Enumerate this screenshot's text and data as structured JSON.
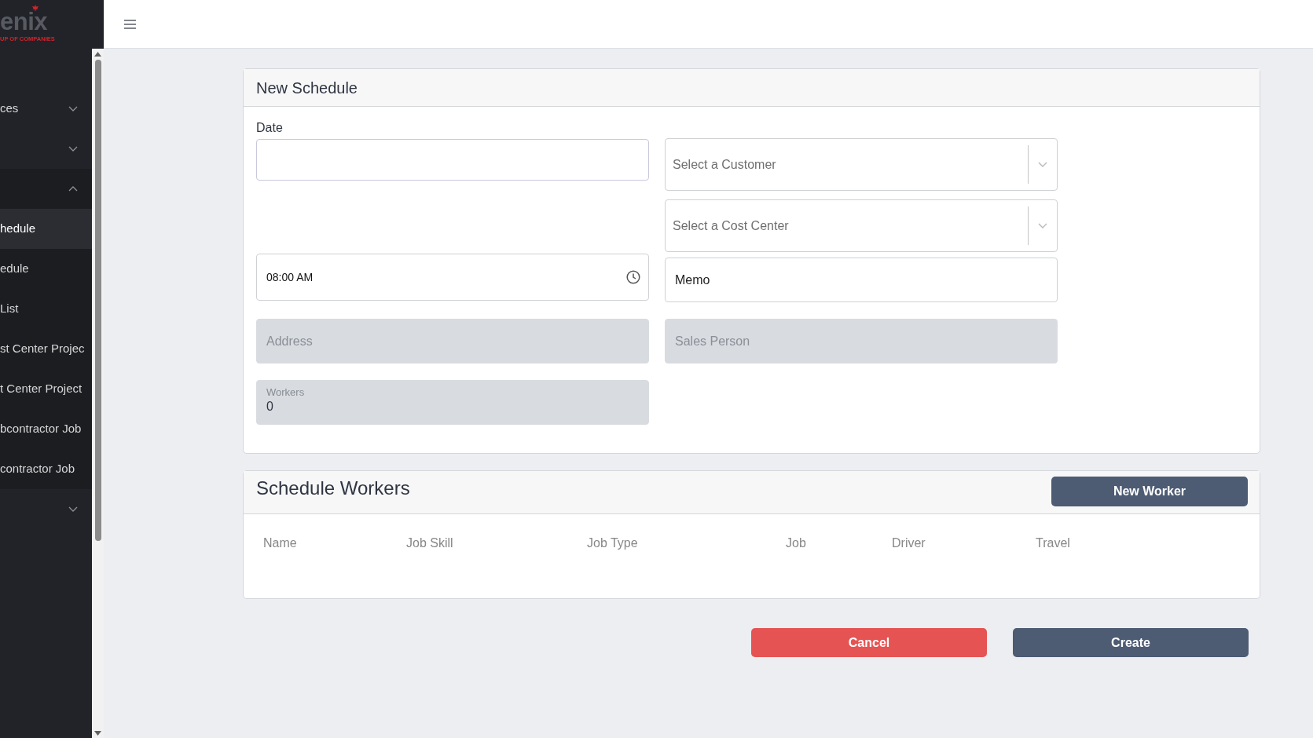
{
  "sidebar": {
    "logo": {
      "text": "enix",
      "tagline": "UP OF COMPANIES"
    },
    "items": [
      {
        "label": "ces",
        "expanded": false
      },
      {
        "expanded": false
      },
      {
        "expanded": true,
        "children": [
          {
            "label": "hedule",
            "selected": true
          },
          {
            "label": "edule",
            "selected": false
          },
          {
            "label": "List",
            "selected": false
          },
          {
            "label": "st Center Projec",
            "selected": false
          },
          {
            "label": "t Center Project",
            "selected": false
          },
          {
            "label": "bcontractor Job",
            "selected": false
          },
          {
            "label": "contractor Job",
            "selected": false
          }
        ]
      },
      {
        "expanded": false
      }
    ]
  },
  "new_schedule": {
    "title": "New Schedule",
    "date": {
      "label": "Date"
    },
    "customer": {
      "placeholder": "Select a Customer"
    },
    "cost_center": {
      "placeholder": "Select a Cost Center"
    },
    "time": {
      "value": "08:00 AM"
    },
    "memo": {
      "placeholder": "Memo"
    },
    "address": {
      "placeholder": "Address",
      "disabled": true
    },
    "sales_person": {
      "placeholder": "Sales Person",
      "disabled": true
    },
    "workers": {
      "label": "Workers",
      "value": "0",
      "disabled": true
    }
  },
  "schedule_workers": {
    "title": "Schedule Workers",
    "new_button": "New Worker",
    "columns": [
      "Name",
      "Job Skill",
      "Job Type",
      "Job",
      "Driver",
      "Travel"
    ]
  },
  "actions": [
    {
      "label": "Cancel",
      "kind": "danger"
    },
    {
      "label": "Create",
      "kind": "primary"
    }
  ]
}
